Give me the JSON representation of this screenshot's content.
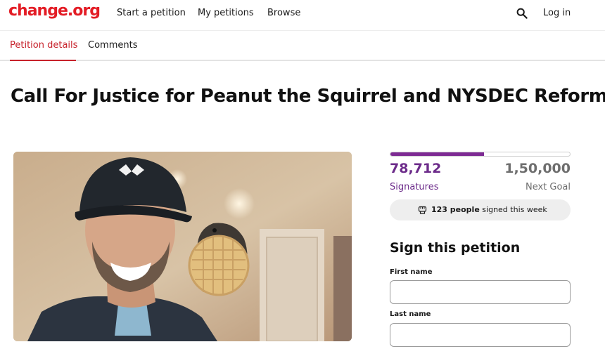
{
  "nav": {
    "logo": "change.org",
    "start_petition": "Start a petition",
    "my_petitions": "My petitions",
    "browse": "Browse",
    "search_icon": "search-icon",
    "login": "Log in"
  },
  "tabs": {
    "details": "Petition details",
    "comments": "Comments"
  },
  "petition": {
    "title": "Call For Justice for Peanut the Squirrel and NYSDEC Reform"
  },
  "stats": {
    "signatures": "78,712",
    "signatures_label": "Signatures",
    "goal": "1,50,000",
    "goal_label": "Next Goal",
    "progress_fraction": 0.52,
    "week_count": "123 people",
    "week_suffix": " signed this week"
  },
  "form": {
    "heading": "Sign this petition",
    "first_name_label": "First name",
    "first_name_value": "",
    "last_name_label": "Last name",
    "last_name_value": ""
  },
  "colors": {
    "brand": "#e31c25",
    "accent": "#7d2a93",
    "tab_active": "#c7222b"
  }
}
